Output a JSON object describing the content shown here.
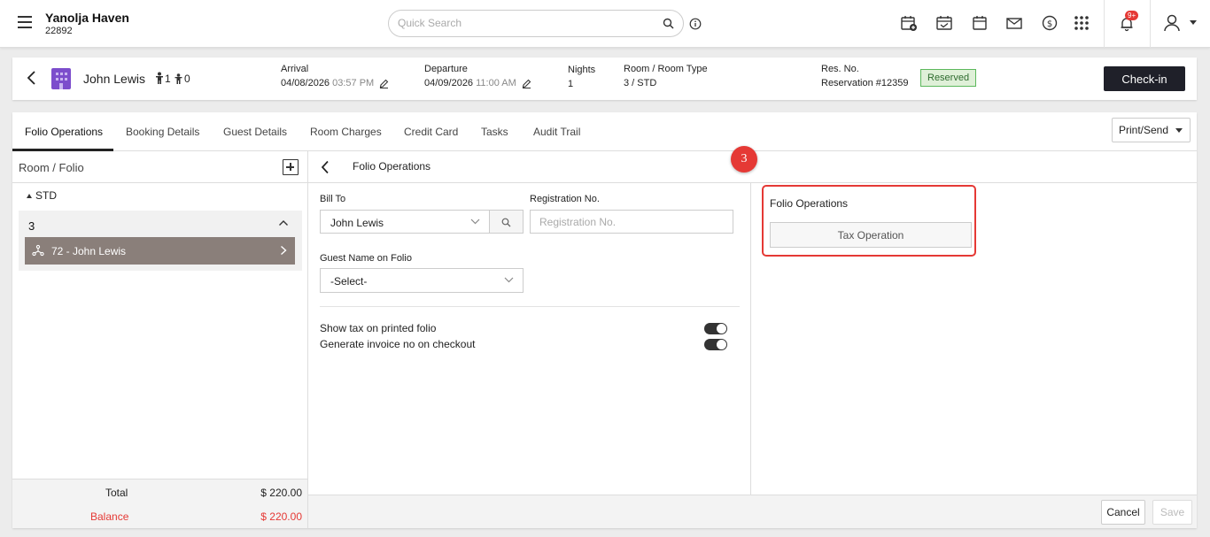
{
  "topbar": {
    "property_name": "Yanolja Haven",
    "property_code": "22892",
    "search_placeholder": "Quick Search",
    "notification_count": "9+",
    "icons": [
      "menu-icon",
      "search-icon",
      "info-icon",
      "calendar-add-icon",
      "calendar-check-icon",
      "calendar-icon",
      "mail-icon",
      "dollar-icon",
      "apps-grid-icon",
      "bell-icon",
      "user-icon",
      "caret-down-icon"
    ]
  },
  "reservation": {
    "guest_name": "John Lewis",
    "adults": "1",
    "children": "0",
    "arrival_label": "Arrival",
    "arrival_date": "04/08/2026",
    "arrival_time": "03:57 PM",
    "departure_label": "Departure",
    "departure_date": "04/09/2026",
    "departure_time": "11:00 AM",
    "nights_label": "Nights",
    "nights_value": "1",
    "room_label": "Room / Room Type",
    "room_value": "3 / STD",
    "resno_label": "Res. No.",
    "resno_value": "Reservation #12359",
    "status": "Reserved",
    "checkin_label": "Check-in"
  },
  "tabs": [
    "Folio Operations",
    "Booking Details",
    "Guest Details",
    "Room Charges",
    "Credit Card",
    "Tasks",
    "Audit Trail"
  ],
  "print_send_label": "Print/Send",
  "left_pane": {
    "title": "Room / Folio",
    "group": "STD",
    "room_number": "3",
    "folio_label": "72 - John Lewis",
    "total_label": "Total",
    "total_value": "$ 220.00",
    "balance_label": "Balance",
    "balance_value": "$ 220.00"
  },
  "content": {
    "title": "Folio Operations",
    "step_number": "3",
    "bill_to_label": "Bill To",
    "bill_to_value": "John Lewis",
    "reg_no_label": "Registration No.",
    "reg_no_placeholder": "Registration No.",
    "guest_name_label": "Guest Name on Folio",
    "guest_name_value": "-Select-",
    "toggle1_label": "Show tax on printed folio",
    "toggle2_label": "Generate invoice no on checkout"
  },
  "operations": {
    "title": "Folio Operations",
    "tax_button": "Tax Operation"
  },
  "footer": {
    "cancel_label": "Cancel",
    "save_label": "Save"
  },
  "colors": {
    "accent_dark": "#1f2029",
    "highlight_red": "#e53935",
    "folio_selected": "#8a7f7a",
    "reserved_green": "#dff0d8",
    "building_purple": "#7c4dcc"
  }
}
